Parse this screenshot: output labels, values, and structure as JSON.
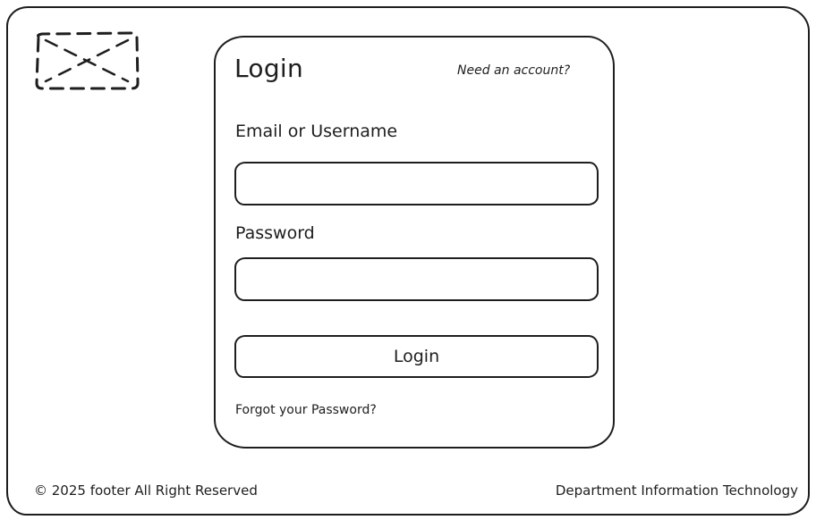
{
  "logo": {
    "icon": "image-placeholder-icon"
  },
  "login_card": {
    "title": "Login",
    "need_account_link": "Need an account?",
    "email": {
      "label": "Email or Username",
      "value": "",
      "placeholder": ""
    },
    "password": {
      "label": "Password",
      "value": "",
      "placeholder": ""
    },
    "login_button_label": "Login",
    "forgot_password_link": "Forgot your Password?"
  },
  "footer": {
    "copyright": "© 2025 footer All Right Reserved",
    "department": "Department Information Technology"
  },
  "colors": {
    "stroke": "#1e1e1e",
    "background": "#ffffff"
  }
}
